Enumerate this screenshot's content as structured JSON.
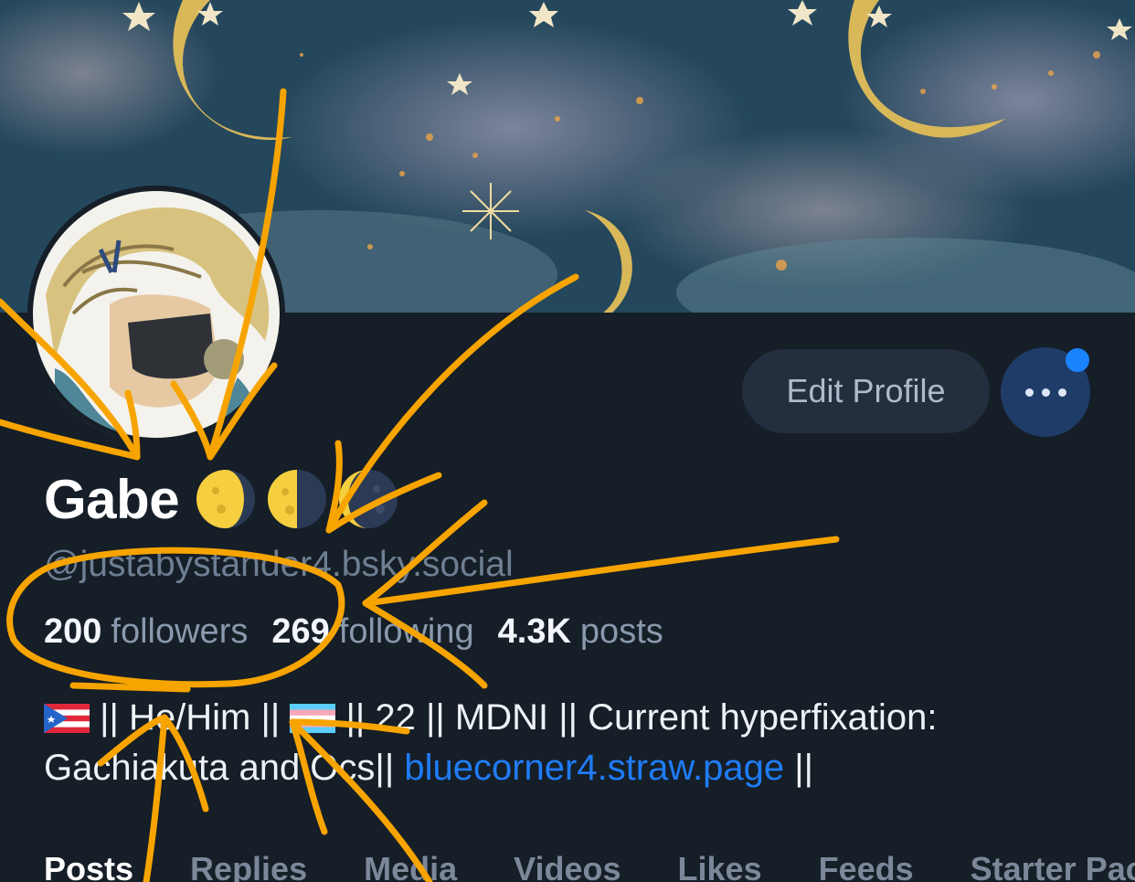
{
  "profile": {
    "display_name": "Gabe",
    "name_emojis": [
      "waning-gibbous-moon-icon",
      "last-quarter-moon-icon",
      "waning-crescent-moon-icon"
    ],
    "handle": "@justabystander4.bsky.social",
    "avatar_icon": "anime-character-avatar"
  },
  "actions": {
    "edit_label": "Edit Profile",
    "more_icon": "ellipsis-icon"
  },
  "stats": {
    "followers_count": "200",
    "followers_label": "followers",
    "following_count": "269",
    "following_label": "following",
    "posts_count": "4.3K",
    "posts_label": "posts"
  },
  "bio": {
    "seg1": "|| He/Him ||",
    "seg2": "|| 22 || MDNI || Current hyperfixation: Gachiakuta and Ocs||",
    "link": "bluecorner4.straw.page",
    "seg3": "||",
    "flag1_icon": "puerto-rico-flag-icon",
    "flag2_icon": "transgender-flag-icon"
  },
  "tabs": [
    "Posts",
    "Replies",
    "Media",
    "Videos",
    "Likes",
    "Feeds",
    "Starter Packs"
  ],
  "colors": {
    "background": "#161e27",
    "link": "#1f7cf7",
    "annotation": "#f7a400",
    "notification": "#1a84ff"
  }
}
